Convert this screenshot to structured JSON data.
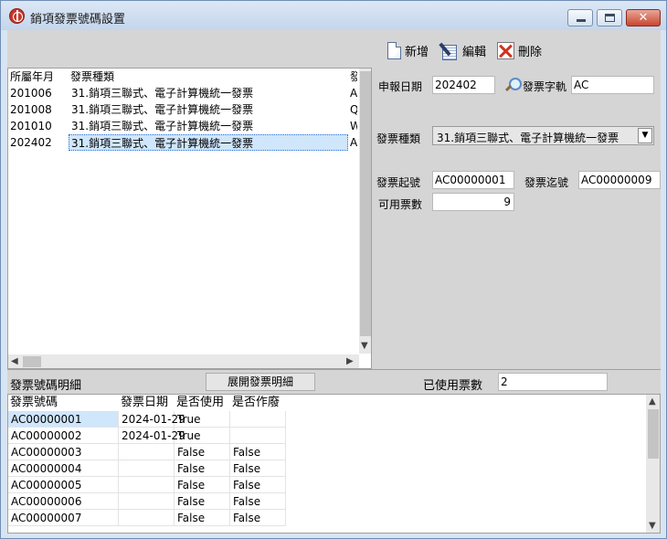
{
  "window": {
    "title": "銷項發票號碼設置",
    "close_glyph": "✕"
  },
  "toolbar": {
    "new_label": "新增",
    "edit_label": "編輯",
    "delete_label": "刪除"
  },
  "top_grid": {
    "headers": [
      "所屬年月",
      "發票種類",
      "發"
    ],
    "rows": [
      {
        "period": "201006",
        "type": "31.銷項三聯式、電子計算機統一發票",
        "more": "A"
      },
      {
        "period": "201008",
        "type": "31.銷項三聯式、電子計算機統一發票",
        "more": "Q"
      },
      {
        "period": "201010",
        "type": "31.銷項三聯式、電子計算機統一發票",
        "more": "W"
      },
      {
        "period": "202402",
        "type": "31.銷項三聯式、電子計算機統一發票",
        "more": "A"
      }
    ],
    "selected_row": 3
  },
  "form": {
    "report_date_label": "申報日期",
    "report_date_value": "202402",
    "track_label": "發票字軌",
    "track_value": "AC",
    "invoice_type_label": "發票種類",
    "invoice_type_value": "31.銷項三聯式、電子計算機統一發票",
    "start_no_label": "發票起號",
    "start_no_value": "AC00000001",
    "end_no_label": "發票迄號",
    "end_no_value": "AC00000009",
    "available_label": "可用票數",
    "available_value": "9"
  },
  "detail_bar": {
    "title": "發票號碼明細",
    "expand_label": "展開發票明細",
    "used_label": "已使用票數",
    "used_value": "2"
  },
  "detail_grid": {
    "headers": [
      "發票號碼",
      "發票日期",
      "是否使用",
      "是否作廢"
    ],
    "rows": [
      {
        "no": "AC00000001",
        "date": "2024-01-29",
        "used": "True",
        "void": ""
      },
      {
        "no": "AC00000002",
        "date": "2024-01-29",
        "used": "True",
        "void": ""
      },
      {
        "no": "AC00000003",
        "date": "",
        "used": "False",
        "void": "False"
      },
      {
        "no": "AC00000004",
        "date": "",
        "used": "False",
        "void": "False"
      },
      {
        "no": "AC00000005",
        "date": "",
        "used": "False",
        "void": "False"
      },
      {
        "no": "AC00000006",
        "date": "",
        "used": "False",
        "void": "False"
      },
      {
        "no": "AC00000007",
        "date": "",
        "used": "False",
        "void": "False"
      }
    ],
    "selected_row": 0
  }
}
